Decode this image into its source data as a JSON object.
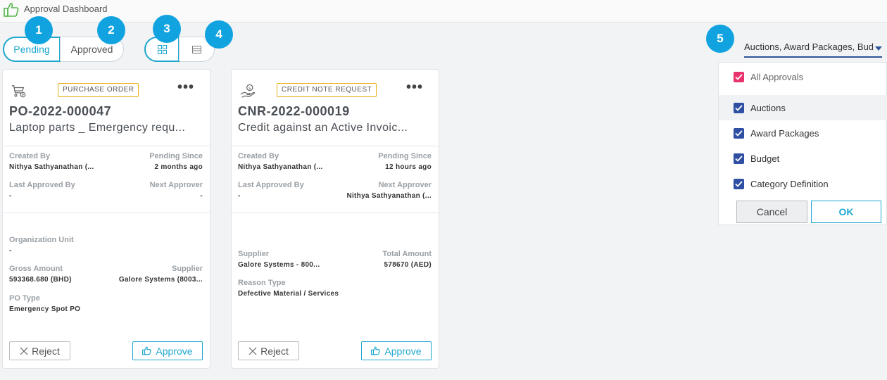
{
  "header": {
    "title": "Approval Dashboard",
    "logo_icon": "thumbs-up-icon"
  },
  "status_toggle": {
    "pending": "Pending",
    "approved": "Approved",
    "active": "Pending"
  },
  "view_toggle": {
    "grid_icon": "grid-view-icon",
    "list_icon": "list-view-icon",
    "active": "grid"
  },
  "markers": [
    "1",
    "2",
    "3",
    "4",
    "5"
  ],
  "filter": {
    "selected_text": "Auctions, Award Packages, Bud",
    "options": [
      {
        "label": "All Approvals",
        "checked": true,
        "color": "#e8336d"
      },
      {
        "label": "Auctions",
        "checked": true,
        "color": "#2f4fa2"
      },
      {
        "label": "Award Packages",
        "checked": true,
        "color": "#2f4fa2"
      },
      {
        "label": "Budget",
        "checked": true,
        "color": "#2f4fa2"
      },
      {
        "label": "Category Definition",
        "checked": true,
        "color": "#2f4fa2"
      }
    ],
    "cancel_label": "Cancel",
    "ok_label": "OK"
  },
  "cards": [
    {
      "icon": "cart-settings-icon",
      "type": "PURCHASE ORDER",
      "number": "PO-2022-000047",
      "description": "Laptop parts _ Emergency requ...",
      "created_by_label": "Created By",
      "created_by": "Nithya Sathyanathan (...",
      "pending_since_label": "Pending Since",
      "pending_since": "2 months ago",
      "last_approved_label": "Last Approved By",
      "last_approved": "-",
      "next_approver_label": "Next Approver",
      "next_approver": "-",
      "f1_label": "Organization Unit",
      "f1": "-",
      "f2_label": "Gross Amount",
      "f2": "593368.680 (BHD)",
      "f3_label": "Supplier",
      "f3": "Galore Systems (8003...",
      "f4_label": "PO Type",
      "f4": "Emergency Spot PO",
      "reject": "Reject",
      "approve": "Approve"
    },
    {
      "icon": "hand-coin-icon",
      "type": "CREDIT NOTE REQUEST",
      "number": "CNR-2022-000019",
      "description": "Credit against an Active Invoic...",
      "created_by_label": "Created By",
      "created_by": "Nithya Sathyanathan (...",
      "pending_since_label": "Pending Since",
      "pending_since": "12 hours ago",
      "last_approved_label": "Last Approved By",
      "last_approved": "-",
      "next_approver_label": "Next Approver",
      "next_approver": "Nithya Sathyanathan (...",
      "f1_label": "Supplier",
      "f1": "Galore Systems - 800...",
      "f2_label": "Total Amount",
      "f2": "578670 (AED)",
      "f3_label": "Reason Type",
      "f3": "Defective Material / Services",
      "reject": "Reject",
      "approve": "Approve"
    }
  ]
}
